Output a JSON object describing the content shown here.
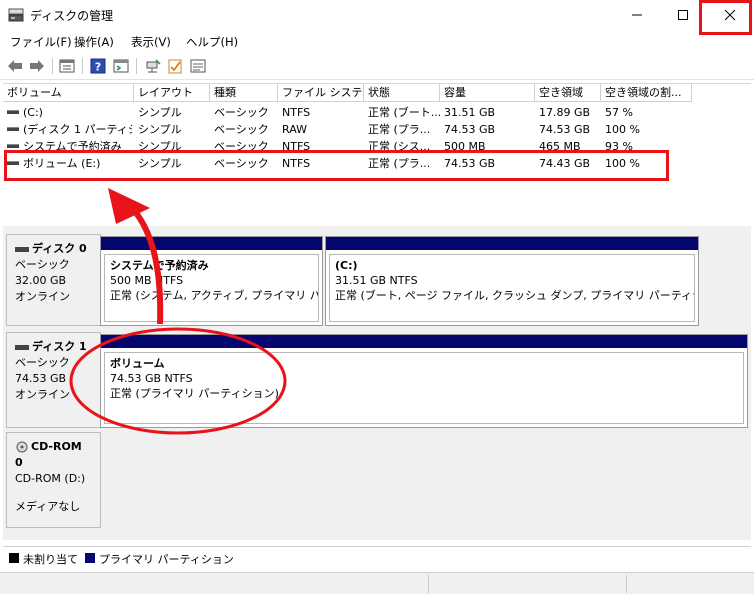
{
  "window": {
    "title": "ディスクの管理"
  },
  "menu": [
    "ファイル(F)",
    "操作(A)",
    "表示(V)",
    "ヘルプ(H)"
  ],
  "list": {
    "columns": [
      "ボリューム",
      "レイアウト",
      "種類",
      "ファイル システム",
      "状態",
      "容量",
      "空き領域",
      "空き領域の割..."
    ],
    "rows": [
      [
        "(C:)",
        "シンプル",
        "ベーシック",
        "NTFS",
        "正常 (ブート...",
        "31.51 GB",
        "17.89 GB",
        "57 %"
      ],
      [
        "(ディスク 1 パーティシ...",
        "シンプル",
        "ベーシック",
        "RAW",
        "正常 (プラ...",
        "74.53 GB",
        "74.53 GB",
        "100 %"
      ],
      [
        "システムで予約済み",
        "シンプル",
        "ベーシック",
        "NTFS",
        "正常 (シス...",
        "500 MB",
        "465 MB",
        "93 %"
      ],
      [
        "ボリューム (E:)",
        "シンプル",
        "ベーシック",
        "NTFS",
        "正常 (プラ...",
        "74.53 GB",
        "74.43 GB",
        "100 %"
      ]
    ]
  },
  "disks": [
    {
      "name": "ディスク 0",
      "type": "ベーシック",
      "size": "32.00 GB",
      "status": "オンライン",
      "partitions": [
        {
          "name": "システムで予約済み",
          "size": "500 MB NTFS",
          "status": "正常 (システム, アクティブ, プライマリ パーティション)"
        },
        {
          "name": "(C:)",
          "size": "31.51 GB NTFS",
          "status": "正常 (ブート, ページ ファイル, クラッシュ ダンプ, プライマリ パーティション)"
        }
      ]
    },
    {
      "name": "ディスク 1",
      "type": "ベーシック",
      "size": "74.53 GB",
      "status": "オンライン",
      "partitions": [
        {
          "name": "ボリューム",
          "size": "74.53 GB NTFS",
          "status": "正常 (プライマリ パーティション)"
        }
      ]
    },
    {
      "name": "CD-ROM 0",
      "drive": "CD-ROM (D:)",
      "status": "メディアなし"
    }
  ],
  "legend": {
    "unallocated": "未割り当て",
    "primary": "プライマリ パーティション"
  },
  "colors": {
    "primary_partition": "#06066f",
    "unallocated": "#000000",
    "annotation": "#e8141a"
  },
  "icons": [
    "disk-management-icon",
    "back-icon",
    "forward-icon",
    "properties-icon",
    "help-icon",
    "console-icon",
    "connect-icon",
    "checklist-icon",
    "settings-icon",
    "minimize-icon",
    "maximize-icon",
    "close-icon"
  ]
}
